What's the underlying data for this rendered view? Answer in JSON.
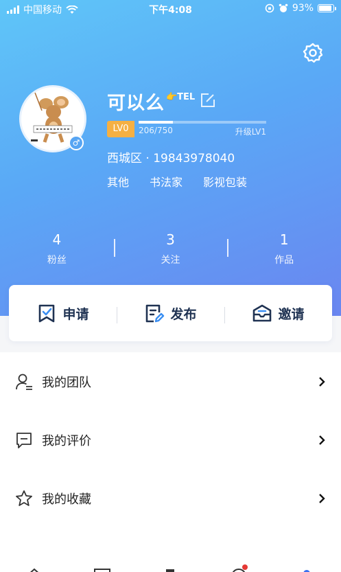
{
  "status_bar": {
    "carrier": "中国移动",
    "time": "下午4:08",
    "battery": "93%"
  },
  "colors": {
    "accent": "#5aa8f6",
    "level_badge": "#f5b043",
    "icon_dark": "#1f3252"
  },
  "profile": {
    "name": "可以么",
    "name_suffix": "👉TEL",
    "level_badge": "LV0",
    "level_progress": "206/750",
    "level_progress_fraction": 0.27,
    "next_level": "升级LV1",
    "location": "西城区 · 19843978040",
    "tags": [
      "其他",
      "书法家",
      "影视包装"
    ],
    "gender": "♂"
  },
  "stats": [
    {
      "value": "4",
      "label": "粉丝"
    },
    {
      "value": "3",
      "label": "关注"
    },
    {
      "value": "1",
      "label": "作品"
    }
  ],
  "actions": [
    {
      "label": "申请",
      "icon": "apply-icon"
    },
    {
      "label": "发布",
      "icon": "publish-icon"
    },
    {
      "label": "邀请",
      "icon": "invite-icon"
    }
  ],
  "menu": [
    {
      "label": "我的团队",
      "icon": "team-icon"
    },
    {
      "label": "我的评价",
      "icon": "review-icon"
    },
    {
      "label": "我的收藏",
      "icon": "favorite-icon"
    }
  ]
}
